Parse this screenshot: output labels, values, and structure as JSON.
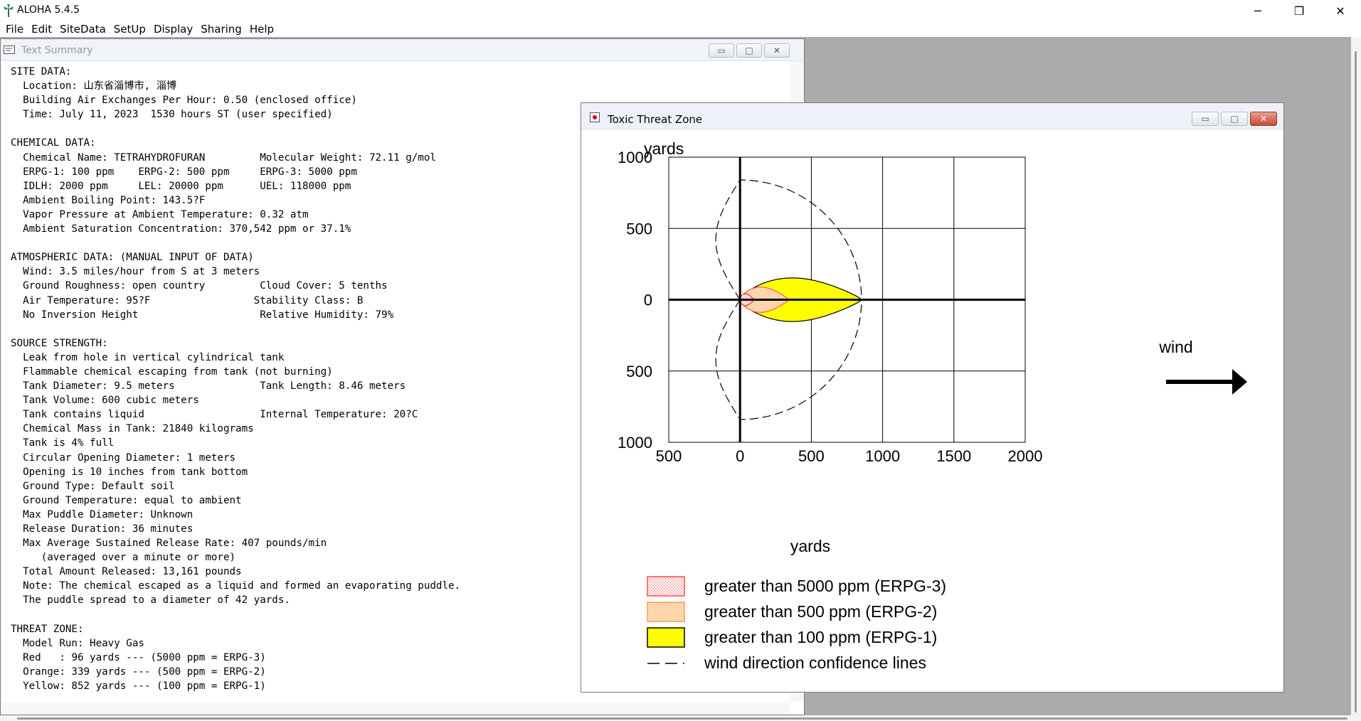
{
  "app": {
    "title": "ALOHA 5.4.5",
    "window_controls": {
      "minimize": "─",
      "restore": "❐",
      "close": "✕"
    }
  },
  "menu": [
    "File",
    "Edit",
    "SiteData",
    "SetUp",
    "Display",
    "Sharing",
    "Help"
  ],
  "text_summary": {
    "title": "Text Summary",
    "lines": [
      "SITE DATA:",
      "  Location: 山东省淄博市, 淄博",
      "  Building Air Exchanges Per Hour: 0.50 (enclosed office)",
      "  Time: July 11, 2023  1530 hours ST (user specified)",
      "",
      "CHEMICAL DATA:",
      "  Chemical Name: TETRAHYDROFURAN         Molecular Weight: 72.11 g/mol",
      "  ERPG-1: 100 ppm    ERPG-2: 500 ppm     ERPG-3: 5000 ppm",
      "  IDLH: 2000 ppm     LEL: 20000 ppm      UEL: 118000 ppm",
      "  Ambient Boiling Point: 143.5?F",
      "  Vapor Pressure at Ambient Temperature: 0.32 atm",
      "  Ambient Saturation Concentration: 370,542 ppm or 37.1%",
      "",
      "ATMOSPHERIC DATA: (MANUAL INPUT OF DATA)",
      "  Wind: 3.5 miles/hour from S at 3 meters",
      "  Ground Roughness: open country         Cloud Cover: 5 tenths",
      "  Air Temperature: 95?F                 Stability Class: B",
      "  No Inversion Height                    Relative Humidity: 79%",
      "",
      "SOURCE STRENGTH:",
      "  Leak from hole in vertical cylindrical tank",
      "  Flammable chemical escaping from tank (not burning)",
      "  Tank Diameter: 9.5 meters              Tank Length: 8.46 meters",
      "  Tank Volume: 600 cubic meters",
      "  Tank contains liquid                   Internal Temperature: 20?C",
      "  Chemical Mass in Tank: 21840 kilograms",
      "  Tank is 4% full",
      "  Circular Opening Diameter: 1 meters",
      "  Opening is 10 inches from tank bottom",
      "  Ground Type: Default soil",
      "  Ground Temperature: equal to ambient",
      "  Max Puddle Diameter: Unknown",
      "  Release Duration: 36 minutes",
      "  Max Average Sustained Release Rate: 407 pounds/min",
      "     (averaged over a minute or more)",
      "  Total Amount Released: 13,161 pounds",
      "  Note: The chemical escaped as a liquid and formed an evaporating puddle.",
      "  The puddle spread to a diameter of 42 yards.",
      "",
      "THREAT ZONE:",
      "  Model Run: Heavy Gas",
      "  Red   : 96 yards --- (5000 ppm = ERPG-3)",
      "  Orange: 339 yards --- (500 ppm = ERPG-2)",
      "  Yellow: 852 yards --- (100 ppm = ERPG-1)"
    ]
  },
  "threat_zone": {
    "title": "Toxic Threat Zone",
    "wind_label": "wind",
    "legend": [
      {
        "label": "greater than 5000 ppm (ERPG-3)",
        "color": "#ff4a4a",
        "style": "dotted-red"
      },
      {
        "label": "greater than 500 ppm (ERPG-2)",
        "color": "#f7a14a",
        "style": "dotted-orange"
      },
      {
        "label": "greater than 100 ppm (ERPG-1)",
        "color": "#ffff00",
        "style": "solid-yellow"
      },
      {
        "label": "wind direction confidence lines",
        "color": "#000000",
        "style": "dash"
      }
    ],
    "chart_data": {
      "type": "area",
      "xlabel": "yards",
      "ylabel": "yards",
      "xlim": [
        -500,
        2000
      ],
      "ylim": [
        -1000,
        1000
      ],
      "x_tick_labels": [
        "500",
        "0",
        "500",
        "1000",
        "1500",
        "2000"
      ],
      "x_tick_values": [
        -500,
        0,
        500,
        1000,
        1500,
        2000
      ],
      "y_tick_labels": [
        "1000",
        "500",
        "0",
        "500",
        "1000"
      ],
      "y_tick_values": [
        1000,
        500,
        0,
        -500,
        -1000
      ],
      "grid": true,
      "zones": [
        {
          "name": "ERPG-1",
          "color": "#ffff00",
          "downwind_yards": 852,
          "max_halfwidth_yards": 155,
          "upwind_yards": 5
        },
        {
          "name": "ERPG-2",
          "color": "#f7a14a",
          "downwind_yards": 339,
          "max_halfwidth_yards": 90,
          "upwind_yards": 5
        },
        {
          "name": "ERPG-3",
          "color": "#ff4a4a",
          "downwind_yards": 96,
          "max_halfwidth_yards": 42,
          "upwind_yards": 8
        }
      ],
      "confidence_lines": {
        "downwind_yards": 852,
        "halfwidth_yards": 840,
        "upwind_yards": 170
      }
    }
  }
}
